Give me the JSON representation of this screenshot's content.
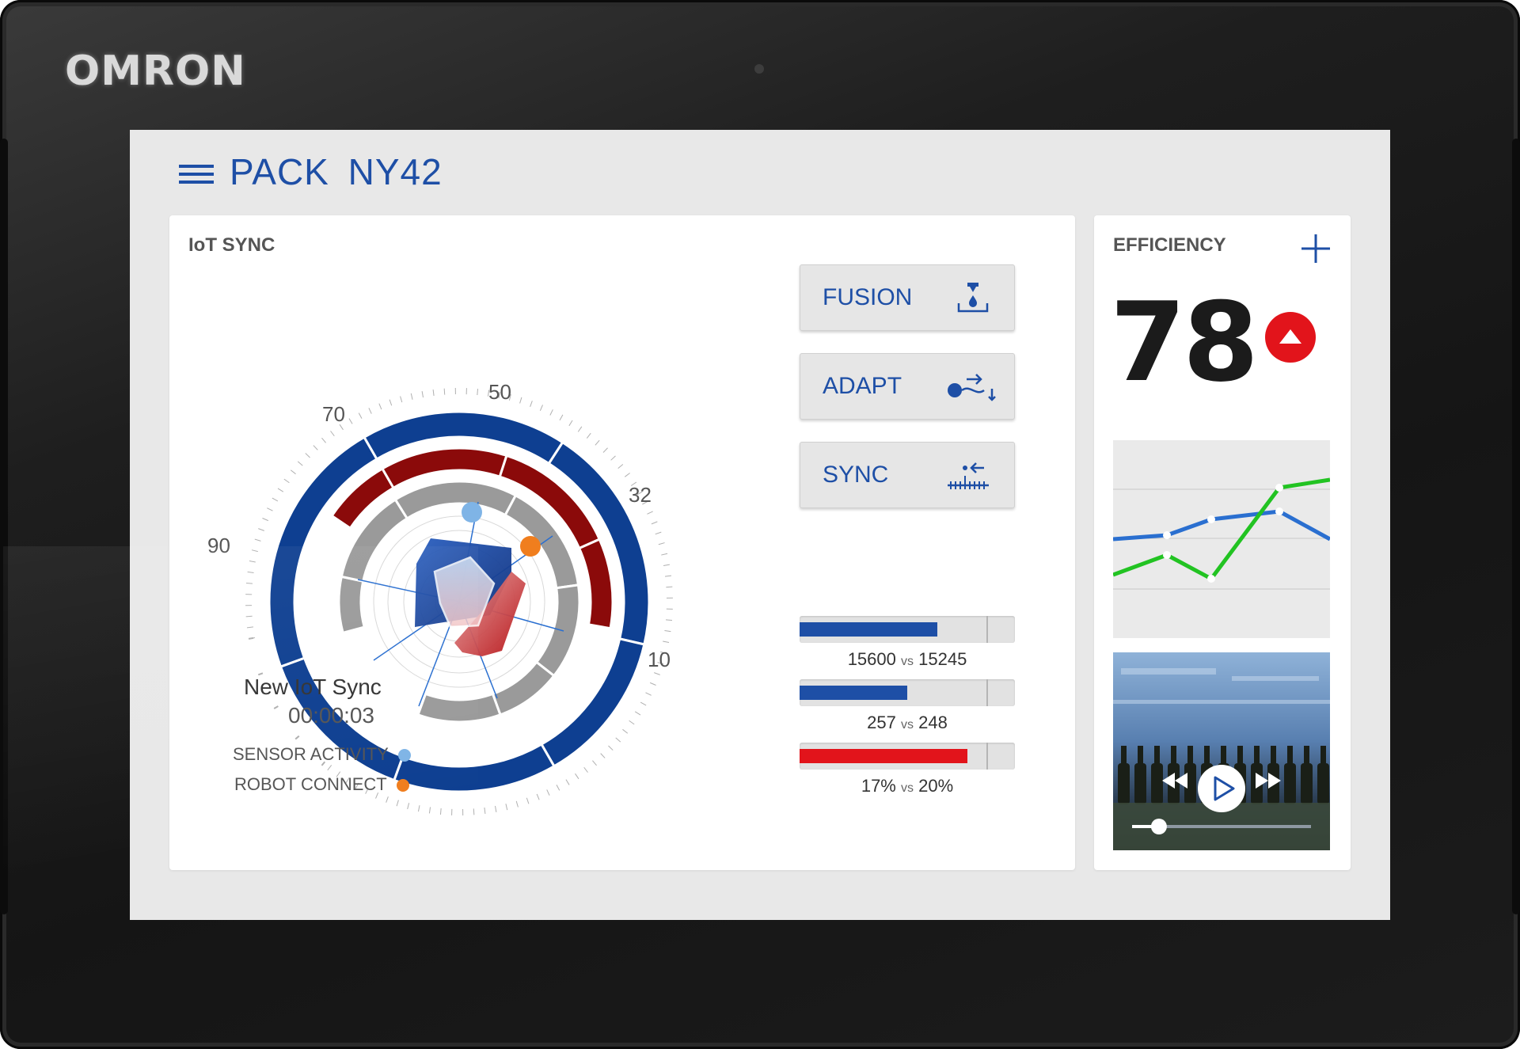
{
  "device": {
    "brand": "OMRON"
  },
  "header": {
    "title": "PACK  NY42"
  },
  "iot": {
    "title": "IoT SYNC",
    "scale_labels": [
      "90",
      "70",
      "50",
      "32",
      "10"
    ],
    "sync_name": "New IoT Sync",
    "sync_time": "00:00:03",
    "legend": [
      {
        "label": "SENSOR ACTIVITY",
        "color": "#7fb4e6"
      },
      {
        "label": "ROBOT CONNECT",
        "color": "#f07e1e"
      }
    ],
    "actions": [
      {
        "label": "FUSION",
        "icon": "fusion-icon"
      },
      {
        "label": "ADAPT",
        "icon": "adapt-icon"
      },
      {
        "label": "SYNC",
        "icon": "sync-icon"
      }
    ],
    "comparisons": [
      {
        "value": "15600",
        "vs": "vs",
        "ref": "15245",
        "fill": 0.64,
        "color": "#1e4fa6"
      },
      {
        "value": "257",
        "vs": "vs",
        "ref": "248",
        "fill": 0.5,
        "color": "#1e4fa6"
      },
      {
        "value": "17%",
        "vs": "vs",
        "ref": "20%",
        "fill": 0.78,
        "color": "#e2141b"
      }
    ]
  },
  "efficiency": {
    "title": "EFFICIENCY",
    "value": "78",
    "trend": "up",
    "trend_icon": "arrow-up-icon",
    "add_icon": "plus-icon",
    "chart": {
      "series": [
        {
          "color": "#2a6fd0",
          "values": [
            0.5,
            0.52,
            0.6,
            0.64,
            0.5
          ]
        },
        {
          "color": "#22c322",
          "values": [
            0.32,
            0.42,
            0.3,
            0.76,
            0.8
          ]
        }
      ]
    },
    "video": {
      "play_icon": "play-icon",
      "rewind_icon": "rewind-icon",
      "forward_icon": "fast-forward-icon",
      "progress": 0.15
    }
  },
  "colors": {
    "accent": "#1e4fa6",
    "alert": "#e2141b",
    "dark_red": "#8b0a0a",
    "grey_ring": "#9a9a9a"
  }
}
